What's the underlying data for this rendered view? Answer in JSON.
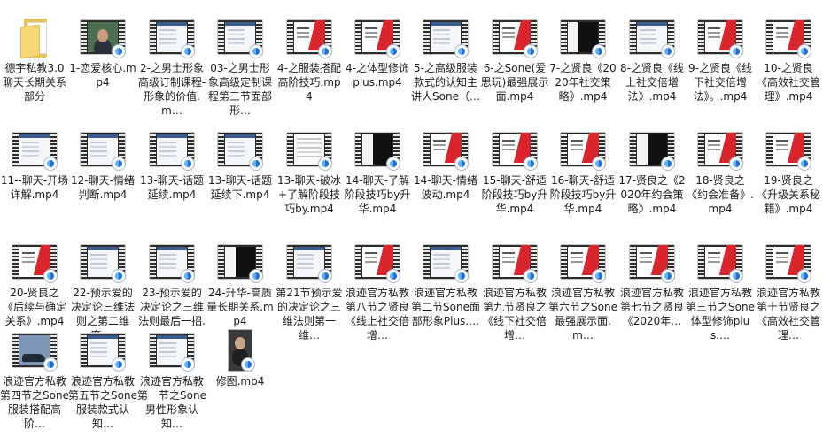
{
  "files": [
    {
      "name": "德宇私教3.0聊天长期关系部分",
      "type": "folder",
      "icon": "folder-icon",
      "thumb": "folder"
    },
    {
      "name": "1-恋爱核心.mp4",
      "type": "video",
      "icon": "video-file-icon",
      "thumb": "face"
    },
    {
      "name": "2-之男士形象高级订制课程-形象的价值.m…",
      "type": "video",
      "icon": "video-file-icon",
      "thumb": "app"
    },
    {
      "name": "03-之男士形象高级定制课程第三节面部形…",
      "type": "video",
      "icon": "video-file-icon",
      "thumb": "app"
    },
    {
      "name": "4-之服装搭配高阶技巧.mp4",
      "type": "video",
      "icon": "video-file-icon",
      "thumb": "red"
    },
    {
      "name": "4-之体型修饰plus.mp4",
      "type": "video",
      "icon": "video-file-icon",
      "thumb": "red"
    },
    {
      "name": "5-之高级服装款式的认知主讲人Sone（…",
      "type": "video",
      "icon": "video-file-icon",
      "thumb": "app"
    },
    {
      "name": "6-之Sone(爱思玩)最强展示面.mp4",
      "type": "video",
      "icon": "video-file-icon",
      "thumb": "red"
    },
    {
      "name": "7-之贤良《2020年社交策略》.mp4",
      "type": "video",
      "icon": "video-file-icon",
      "thumb": "dark"
    },
    {
      "name": "8-之贤良《线上社交倍增法》.mp4",
      "type": "video",
      "icon": "video-file-icon",
      "thumb": "app"
    },
    {
      "name": "9-之贤良《线下社交倍增法》。.mp4",
      "type": "video",
      "icon": "video-file-icon",
      "thumb": "red"
    },
    {
      "name": "10-之贤良《高效社交管理》.mp4",
      "type": "video",
      "icon": "video-file-icon",
      "thumb": "red"
    },
    {
      "name": "11--聊天-开场详解.mp4",
      "type": "video",
      "icon": "video-file-icon",
      "thumb": "app"
    },
    {
      "name": "12-聊天-情绪判断.mp4",
      "type": "video",
      "icon": "video-file-icon",
      "thumb": "app"
    },
    {
      "name": "13-聊天-话题延续.mp4",
      "type": "video",
      "icon": "video-file-icon",
      "thumb": "app"
    },
    {
      "name": "13-聊天-话题延续下.mp4",
      "type": "video",
      "icon": "video-file-icon",
      "thumb": "app"
    },
    {
      "name": "13-聊天-破冰+了解阶段技巧by.mp4",
      "type": "video",
      "icon": "video-file-icon",
      "thumb": "doc"
    },
    {
      "name": "14-聊天-了解阶段技巧by升华.mp4",
      "type": "video",
      "icon": "video-file-icon",
      "thumb": "dark"
    },
    {
      "name": "14-聊天-情绪波动.mp4",
      "type": "video",
      "icon": "video-file-icon",
      "thumb": "red"
    },
    {
      "name": "15-聊天-舒适阶段技巧by升华.mp4",
      "type": "video",
      "icon": "video-file-icon",
      "thumb": "red"
    },
    {
      "name": "16-聊天-舒适阶段技巧by升华.mp4",
      "type": "video",
      "icon": "video-file-icon",
      "thumb": "red"
    },
    {
      "name": "17-贤良之《2020年约会策略》.mp4",
      "type": "video",
      "icon": "video-file-icon",
      "thumb": "dark"
    },
    {
      "name": "18-贤良之《约会准备》.mp4",
      "type": "video",
      "icon": "video-file-icon",
      "thumb": "red"
    },
    {
      "name": "19-贤良之《升级关系秘籍》.mp4",
      "type": "video",
      "icon": "video-file-icon",
      "thumb": "red"
    },
    {
      "name": "20-贤良之《后续与确定关系》.mp4",
      "type": "video",
      "icon": "video-file-icon",
      "thumb": "red"
    },
    {
      "name": "22-预示爱的决定论三维法则之第二维度.…",
      "type": "video",
      "icon": "video-file-icon",
      "thumb": "app"
    },
    {
      "name": "23-预示爱的决定论之三维法则最后一招.m…",
      "type": "video",
      "icon": "video-file-icon",
      "thumb": "app"
    },
    {
      "name": "24-升华-高质量长期关系.mp4",
      "type": "video",
      "icon": "video-file-icon",
      "thumb": "dark"
    },
    {
      "name": "第21节预示爱的决定论之三维法则第一维…",
      "type": "video",
      "icon": "video-file-icon",
      "thumb": "app"
    },
    {
      "name": "浪迹官方私教第八节之贤良《线上社交倍增…",
      "type": "video",
      "icon": "video-file-icon",
      "thumb": "red"
    },
    {
      "name": "浪迹官方私教第二节Sone面部形象Plus.…",
      "type": "video",
      "icon": "video-file-icon",
      "thumb": "app"
    },
    {
      "name": "浪迹官方私教第九节贤良之《线下社交倍增…",
      "type": "video",
      "icon": "video-file-icon",
      "thumb": "red"
    },
    {
      "name": "浪迹官方私教第六节之Sone最强展示面.m…",
      "type": "video",
      "icon": "video-file-icon",
      "thumb": "red"
    },
    {
      "name": "浪迹官方私教第七节之贤良《2020年…",
      "type": "video",
      "icon": "video-file-icon",
      "thumb": "red"
    },
    {
      "name": "浪迹官方私教第三节之Sone体型修饰plus.…",
      "type": "video",
      "icon": "video-file-icon",
      "thumb": "red"
    },
    {
      "name": "浪迹官方私教第十节贤良之《高效社交管理…",
      "type": "video",
      "icon": "video-file-icon",
      "thumb": "red"
    },
    {
      "name": "浪迹官方私教第四节之Sone服装搭配高阶…",
      "type": "video",
      "icon": "video-file-icon",
      "thumb": "car"
    },
    {
      "name": "浪迹官方私教第五节之Sone服装款式认知…",
      "type": "video",
      "icon": "video-file-icon",
      "thumb": "app"
    },
    {
      "name": "浪迹官方私教第一节之Sone男性形象认知…",
      "type": "video",
      "icon": "video-file-icon",
      "thumb": "app"
    },
    {
      "name": "修图.mp4",
      "type": "video",
      "icon": "video-file-icon",
      "thumb": "portrait"
    }
  ]
}
